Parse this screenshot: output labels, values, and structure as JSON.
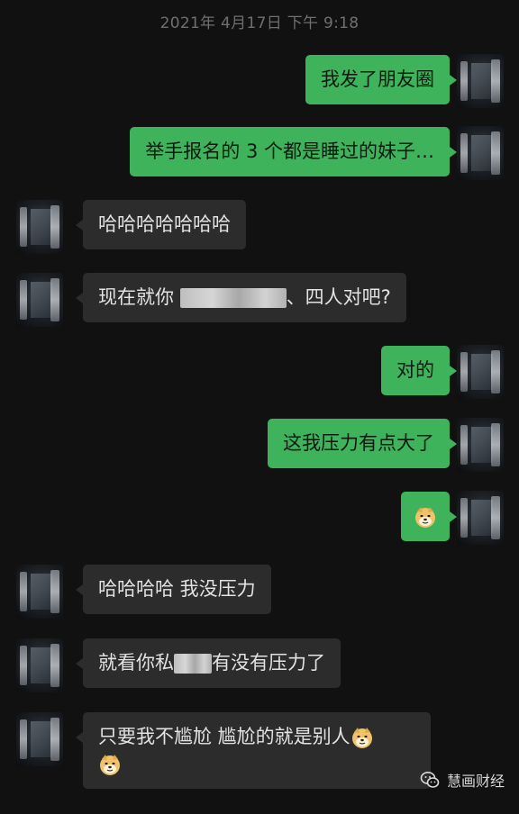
{
  "timestamp": "2021年 4月17日 下午 9:18",
  "messages": [
    {
      "side": "right",
      "text": "我发了朋友圈"
    },
    {
      "side": "right",
      "text": "举手报名的 3 个都是睡过的妹子…"
    },
    {
      "side": "left",
      "text": "哈哈哈哈哈哈哈"
    },
    {
      "side": "left",
      "text_before": "现在就你 ",
      "text_after": "、四人对吧?"
    },
    {
      "side": "right",
      "text": "对的"
    },
    {
      "side": "right",
      "text": "这我压力有点大了"
    },
    {
      "side": "right",
      "emoji": "doge-emoji"
    },
    {
      "side": "left",
      "text": "哈哈哈哈 我没压力"
    },
    {
      "side": "left",
      "text_before": "就看你私",
      "text_after": "有没有压力了"
    },
    {
      "side": "left",
      "line1": "只要我不尴尬 尴尬的就是别人",
      "emoji": "doge-emoji"
    }
  ],
  "brand": {
    "name": "慧画财经",
    "icon": "wechat-official-account-icon"
  },
  "colors": {
    "background": "#111111",
    "sent_bubble": "#3fb25c",
    "received_bubble": "#2c2c2c",
    "timestamp": "#6f6f6f"
  }
}
